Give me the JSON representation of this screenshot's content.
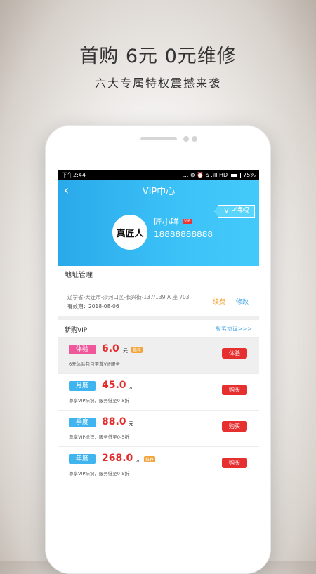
{
  "promo": {
    "headline": "首购 6元  0元维修",
    "subline": "六大专属特权震撼来袭"
  },
  "status_bar": {
    "time": "下午2:44",
    "icons": "... ⊛ ⏰ ⌂ .ıll HD",
    "battery": "75%"
  },
  "header": {
    "title": "VIP中心",
    "back_icon": "‹",
    "ribbon": "VIP特权"
  },
  "user": {
    "avatar_text": "真匠人",
    "name": "匠小咩",
    "vip_badge": "VIP",
    "phone": "18888888888"
  },
  "address": {
    "section_title": "地址管理",
    "line": "辽宁省-大连市-沙河口区-长兴街-137/139 A 座 703",
    "expiry": "有效期：2018-08-06",
    "renew_label": "续费",
    "modify_label": "修改"
  },
  "new_vip": {
    "title": "新购VIP",
    "agreement_link": "服务协议>>>"
  },
  "plans": [
    {
      "tag": "体验",
      "tag_color": "#f0569a",
      "price": "6.0",
      "unit": "元",
      "badge": "推荐",
      "desc": "6元体验包月至尊VIP服务",
      "button": "体验"
    },
    {
      "tag": "月度",
      "tag_color": "#3fb4ee",
      "price": "45.0",
      "unit": "元",
      "badge": "",
      "desc": "尊享VIP标识，服务低至0-5折",
      "button": "购买"
    },
    {
      "tag": "季度",
      "tag_color": "#3fb4ee",
      "price": "88.0",
      "unit": "元",
      "badge": "",
      "desc": "尊享VIP标识，服务低至0-5折",
      "button": "购买"
    },
    {
      "tag": "年度",
      "tag_color": "#3fb4ee",
      "price": "268.0",
      "unit": "元",
      "badge": "推荐",
      "desc": "尊享VIP标识，服务低至0-5折",
      "button": "购买"
    }
  ],
  "colors": {
    "accent_blue": "#2aa9ea",
    "price_red": "#e42b2b",
    "button_red": "#e63030",
    "renew_orange": "#f39c25",
    "link_blue": "#46a7e6"
  }
}
